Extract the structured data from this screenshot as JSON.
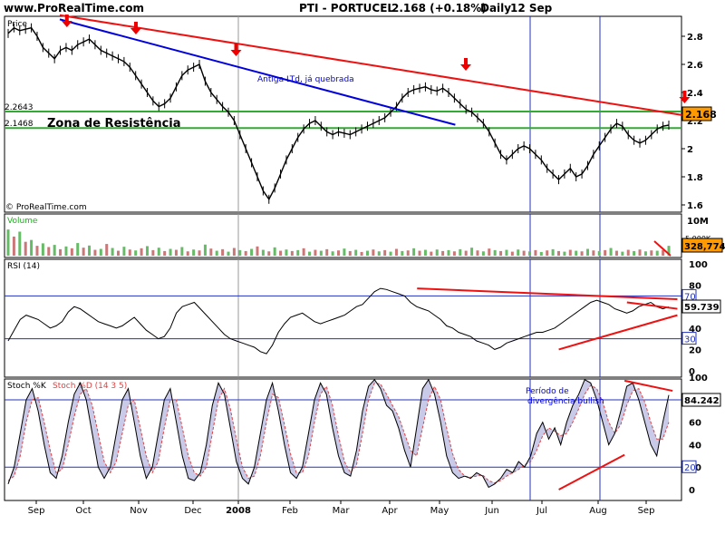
{
  "header": {
    "site": "www.ProRealTime.com",
    "instrument": "PTI - PORTUCEL",
    "last": "2.168 (+0.18%)",
    "period": "Daily",
    "date": "12 Sep"
  },
  "colors": {
    "price_line": "#000000",
    "resistance": "#33aa33",
    "blue_trend": "#0000dd",
    "red_trend": "#ee1111",
    "arrow": "#ee0000",
    "stoch_k": "#000000",
    "stoch_d": "#dd4444",
    "stoch_fill": "#8888cc",
    "last_badge": "#ff9900"
  },
  "chart_data": [
    {
      "type": "line",
      "panel": "price",
      "title": "Price",
      "watermark": "© ProRealTime.com",
      "ylim": [
        1.55,
        2.95
      ],
      "y_ticks": [
        "2.8",
        "2.6",
        "2.4",
        "2.2",
        "2",
        "1.8",
        "1.6"
      ],
      "x_months": [
        "Sep",
        "Oct",
        "Nov",
        "Dec",
        "2008",
        "Feb",
        "Mar",
        "Apr",
        "May",
        "Jun",
        "Jul",
        "Aug",
        "Sep"
      ],
      "resistance_zone": {
        "label": "Zona de Resistência",
        "upper": 2.2643,
        "lower": 2.1468,
        "upper_label": "2.2643",
        "lower_label": "2.1468"
      },
      "trendlines": [
        {
          "name": "Antiga LTd, já quebrada",
          "from": [
            0.5,
            2.92
          ],
          "to": [
            8.3,
            2.17
          ]
        },
        {
          "name": "red-resistance",
          "from": [
            0.5,
            2.95
          ],
          "to": [
            13.1,
            2.22
          ]
        }
      ],
      "arrows_at_month": [
        0.65,
        1.95,
        3.95,
        8.5,
        12.8
      ],
      "last_value": "2.168",
      "series": [
        {
          "values": [
            2.82,
            2.86,
            2.84,
            2.85,
            2.86,
            2.8,
            2.72,
            2.68,
            2.64,
            2.7,
            2.72,
            2.7,
            2.74,
            2.76,
            2.78,
            2.74,
            2.7,
            2.68,
            2.66,
            2.64,
            2.62,
            2.58,
            2.52,
            2.46,
            2.4,
            2.34,
            2.3,
            2.32,
            2.36,
            2.44,
            2.52,
            2.56,
            2.58,
            2.6,
            2.48,
            2.4,
            2.35,
            2.3,
            2.26,
            2.2,
            2.1,
            2.0,
            1.9,
            1.8,
            1.7,
            1.64,
            1.72,
            1.82,
            1.92,
            2.0,
            2.08,
            2.14,
            2.18,
            2.2,
            2.16,
            2.12,
            2.1,
            2.12,
            2.11,
            2.1,
            2.12,
            2.14,
            2.16,
            2.18,
            2.2,
            2.22,
            2.26,
            2.3,
            2.36,
            2.4,
            2.42,
            2.43,
            2.44,
            2.42,
            2.41,
            2.43,
            2.4,
            2.36,
            2.32,
            2.28,
            2.26,
            2.22,
            2.18,
            2.12,
            2.04,
            1.96,
            1.92,
            1.96,
            2.0,
            2.02,
            2.0,
            1.96,
            1.92,
            1.86,
            1.82,
            1.78,
            1.82,
            1.86,
            1.8,
            1.82,
            1.88,
            1.96,
            2.02,
            2.08,
            2.14,
            2.18,
            2.16,
            2.1,
            2.06,
            2.04,
            2.06,
            2.1,
            2.14,
            2.16,
            2.168
          ]
        }
      ]
    },
    {
      "type": "bar",
      "panel": "volume",
      "title": "Volume",
      "y_ticks": [
        "10M",
        "5,000K"
      ],
      "last_value": "328,774",
      "values": [
        8.5,
        6.2,
        7.8,
        4.5,
        5.1,
        3.2,
        4.0,
        2.8,
        3.5,
        2.1,
        3.0,
        2.4,
        4.1,
        2.6,
        3.3,
        1.9,
        2.2,
        3.8,
        2.5,
        1.6,
        2.9,
        2.0,
        1.7,
        2.4,
        3.1,
        1.8,
        2.6,
        1.5,
        2.2,
        1.9,
        2.8,
        1.4,
        2.0,
        1.7,
        3.6,
        2.3,
        1.6,
        2.1,
        1.3,
        2.5,
        1.8,
        1.5,
        2.2,
        3.0,
        1.9,
        1.4,
        2.7,
        1.6,
        2.0,
        1.5,
        1.8,
        2.4,
        1.3,
        1.9,
        1.6,
        2.1,
        1.4,
        1.7,
        2.3,
        1.5,
        1.9,
        1.2,
        1.6,
        2.0,
        1.4,
        1.8,
        1.3,
        2.2,
        1.5,
        1.7,
        2.4,
        1.6,
        1.9,
        1.3,
        2.0,
        1.5,
        1.8,
        1.4,
        2.1,
        1.6,
        2.6,
        1.7,
        1.4,
        2.3,
        1.8,
        1.5,
        1.9,
        1.3,
        2.0,
        1.6,
        1.4,
        1.8,
        1.2,
        1.7,
        2.1,
        1.5,
        1.3,
        1.9,
        1.6,
        1.4,
        2.2,
        1.7,
        1.5,
        1.8,
        2.5,
        1.6,
        1.3,
        1.9,
        1.5,
        2.0,
        1.4,
        1.7,
        1.6,
        1.8,
        3.2
      ]
    },
    {
      "type": "line",
      "panel": "rsi",
      "title": "RSI (14)",
      "ylim": [
        0,
        100
      ],
      "y_ticks": [
        "100",
        "80",
        "60",
        "40",
        "20",
        "0"
      ],
      "levels": [
        70,
        30
      ],
      "level_labels": [
        "70",
        "30"
      ],
      "last_value": "59.739",
      "series": [
        {
          "name": "RSI (14)",
          "values": [
            28,
            38,
            48,
            52,
            50,
            48,
            44,
            40,
            42,
            46,
            55,
            60,
            58,
            54,
            50,
            46,
            44,
            42,
            40,
            42,
            46,
            50,
            44,
            38,
            34,
            30,
            32,
            40,
            54,
            60,
            62,
            64,
            58,
            52,
            46,
            40,
            34,
            30,
            28,
            26,
            24,
            22,
            18,
            16,
            24,
            36,
            44,
            50,
            52,
            54,
            50,
            46,
            44,
            46,
            48,
            50,
            52,
            56,
            60,
            62,
            68,
            74,
            77,
            76,
            74,
            72,
            70,
            64,
            60,
            58,
            56,
            52,
            48,
            42,
            40,
            36,
            34,
            32,
            28,
            26,
            24,
            20,
            22,
            26,
            28,
            30,
            32,
            34,
            36,
            36,
            38,
            40,
            44,
            48,
            52,
            56,
            60,
            64,
            66,
            64,
            62,
            58,
            56,
            54,
            56,
            60,
            62,
            64,
            60,
            58,
            59.739
          ]
        }
      ],
      "trendlines": [
        {
          "from": [
            7.55,
            77
          ],
          "to": [
            12.65,
            67
          ]
        },
        {
          "from": [
            10.3,
            20
          ],
          "to": [
            12.65,
            52
          ]
        },
        {
          "from": [
            11.6,
            64
          ],
          "to": [
            12.65,
            58
          ]
        }
      ]
    },
    {
      "type": "line",
      "panel": "stochastic",
      "title_k": "Stoch %K",
      "title_d": "Stoch %D (14 3 5)",
      "ylim": [
        -3,
        106
      ],
      "y_ticks": [
        "100",
        "80",
        "60",
        "40",
        "20",
        "0"
      ],
      "levels": [
        80,
        20
      ],
      "level_labels": [
        "80",
        "20"
      ],
      "last_value": "84.242",
      "annotation": "Período de divergência bullish",
      "series": [
        {
          "name": "Stoch %K",
          "values": [
            5,
            20,
            50,
            80,
            90,
            70,
            40,
            15,
            10,
            30,
            60,
            85,
            95,
            80,
            50,
            20,
            10,
            20,
            50,
            80,
            90,
            60,
            30,
            10,
            20,
            50,
            80,
            90,
            60,
            30,
            10,
            8,
            15,
            40,
            75,
            95,
            85,
            55,
            25,
            10,
            5,
            20,
            50,
            80,
            95,
            70,
            40,
            15,
            10,
            20,
            50,
            80,
            95,
            85,
            55,
            30,
            15,
            12,
            35,
            70,
            92,
            98,
            90,
            75,
            70,
            55,
            35,
            20,
            55,
            90,
            98,
            85,
            60,
            30,
            15,
            10,
            12,
            10,
            15,
            12,
            2,
            5,
            10,
            18,
            15,
            25,
            20,
            30,
            50,
            60,
            45,
            55,
            40,
            60,
            75,
            85,
            98,
            95,
            80,
            60,
            40,
            50,
            70,
            92,
            95,
            80,
            60,
            40,
            30,
            60,
            84.242
          ]
        },
        {
          "name": "Stoch %D",
          "values": [
            8,
            12,
            30,
            60,
            80,
            82,
            60,
            35,
            15,
            18,
            40,
            65,
            85,
            90,
            75,
            50,
            25,
            15,
            25,
            50,
            75,
            80,
            55,
            30,
            15,
            25,
            55,
            80,
            80,
            55,
            30,
            15,
            12,
            20,
            50,
            80,
            90,
            72,
            45,
            20,
            10,
            12,
            30,
            60,
            85,
            82,
            58,
            32,
            15,
            15,
            30,
            60,
            85,
            92,
            75,
            48,
            25,
            15,
            22,
            50,
            80,
            95,
            94,
            85,
            75,
            65,
            50,
            35,
            30,
            55,
            80,
            92,
            80,
            55,
            32,
            18,
            12,
            11,
            12,
            13,
            8,
            6,
            8,
            12,
            15,
            18,
            22,
            25,
            35,
            48,
            55,
            52,
            48,
            50,
            60,
            72,
            85,
            93,
            90,
            78,
            60,
            50,
            58,
            75,
            88,
            90,
            78,
            60,
            45,
            45,
            60
          ]
        }
      ],
      "trendlines": [
        {
          "from": [
            10.3,
            0
          ],
          "to": [
            11.55,
            31
          ]
        },
        {
          "from": [
            11.55,
            97
          ],
          "to": [
            12.55,
            88
          ]
        }
      ]
    }
  ]
}
